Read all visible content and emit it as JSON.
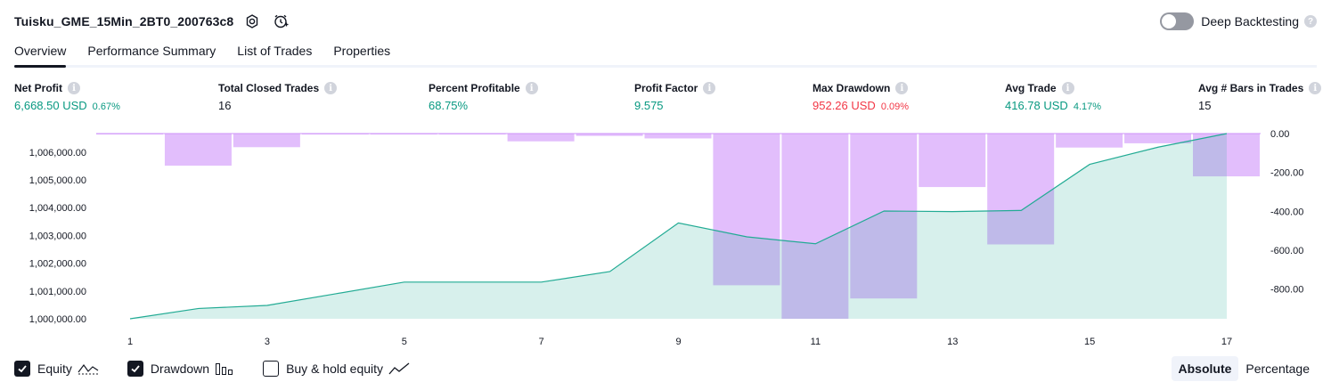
{
  "header": {
    "strategy_name": "Tuisku_GME_15Min_2BT0_200763c8",
    "icons": [
      "settings-icon",
      "alert-clock-icon"
    ]
  },
  "deep_backtesting": {
    "label": "Deep Backtesting",
    "enabled": false,
    "help": "?"
  },
  "tabs": [
    {
      "label": "Overview",
      "active": true
    },
    {
      "label": "Performance Summary",
      "active": false
    },
    {
      "label": "List of Trades",
      "active": false
    },
    {
      "label": "Properties",
      "active": false
    }
  ],
  "stats": {
    "net_profit": {
      "label": "Net Profit",
      "value": "6,668.50 USD",
      "pct": "0.67%"
    },
    "total_closed_trades": {
      "label": "Total Closed Trades",
      "value": "16"
    },
    "percent_profitable": {
      "label": "Percent Profitable",
      "value": "68.75%"
    },
    "profit_factor": {
      "label": "Profit Factor",
      "value": "9.575"
    },
    "max_drawdown": {
      "label": "Max Drawdown",
      "value": "952.26 USD",
      "pct": "0.09%"
    },
    "avg_trade": {
      "label": "Avg Trade",
      "value": "416.78 USD",
      "pct": "4.17%"
    },
    "avg_bars": {
      "label": "Avg # Bars in Trades",
      "value": "15"
    },
    "info": "i"
  },
  "chart_data": {
    "type": "line",
    "x": [
      1,
      2,
      3,
      4,
      5,
      6,
      7,
      8,
      9,
      10,
      11,
      12,
      13,
      14,
      15,
      16,
      17
    ],
    "x_tick_labels": [
      "1",
      "3",
      "5",
      "7",
      "9",
      "11",
      "13",
      "15",
      "17"
    ],
    "xlim": [
      1,
      17
    ],
    "series": [
      {
        "name": "Equity",
        "axis": "left",
        "type": "area",
        "values": [
          1000000,
          1000370,
          1000480,
          1000900,
          1001320,
          1001320,
          1001320,
          1001700,
          1003450,
          1002950,
          1002700,
          1003880,
          1003860,
          1003900,
          1005560,
          1006180,
          1006668.5
        ]
      },
      {
        "name": "Drawdown",
        "axis": "right",
        "type": "bar",
        "values": [
          -3,
          -165,
          -70,
          -3,
          -3,
          -3,
          -40,
          -12,
          -25,
          -780,
          -952.26,
          -848,
          -275,
          -570,
          -72,
          -50,
          -220
        ]
      }
    ],
    "left_axis": {
      "ticks": [
        "1,006,000.00",
        "1,005,000.00",
        "1,004,000.00",
        "1,003,000.00",
        "1,002,000.00",
        "1,001,000.00",
        "1,000,000.00"
      ],
      "ylim": [
        1000000,
        1006668.5
      ]
    },
    "right_axis": {
      "ticks": [
        "0.00",
        "-200.00",
        "-400.00",
        "-600.00",
        "-800.00"
      ],
      "ylim": [
        -952.26,
        0
      ]
    },
    "colors": {
      "equity_line": "#22ab94",
      "equity_fill": "#22ab94",
      "drawdown_bar": "#ce93fa"
    },
    "grid": false
  },
  "legend": [
    {
      "label": "Equity",
      "checked": true,
      "icon": "equity-line-icon"
    },
    {
      "label": "Drawdown",
      "checked": true,
      "icon": "drawdown-bars-icon"
    },
    {
      "label": "Buy & hold equity",
      "checked": false,
      "icon": "buy-hold-line-icon"
    }
  ],
  "modes": [
    {
      "label": "Absolute",
      "active": true
    },
    {
      "label": "Percentage",
      "active": false
    }
  ]
}
